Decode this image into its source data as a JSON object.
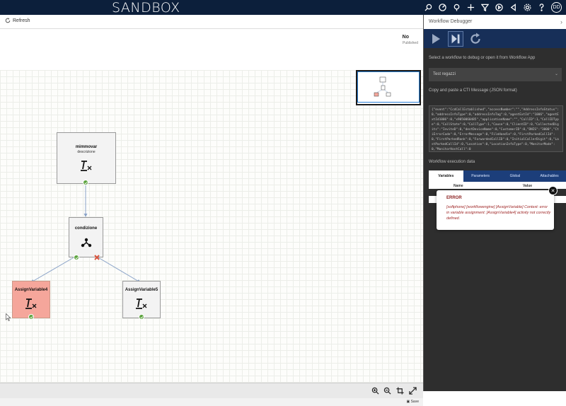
{
  "app": {
    "title": "SANDBOX",
    "user_initials": "DD"
  },
  "topbar": {
    "icons": [
      "search-icon",
      "gauge-icon",
      "pin-icon",
      "plus-icon",
      "filter-icon",
      "play-circle-icon",
      "back-icon",
      "gear-icon",
      "help-icon"
    ]
  },
  "toolbar": {
    "refresh_label": "Refresh"
  },
  "status": {
    "published_value": "No",
    "published_label": "Published"
  },
  "workflow": {
    "nodes": [
      {
        "title": "mimmovar",
        "description": "descrizione",
        "icon": "variable-icon"
      },
      {
        "title": "condizione",
        "description": "",
        "icon": "branch-icon"
      },
      {
        "title": "AssignVariable4",
        "description": "",
        "icon": "variable-icon",
        "state": "error"
      },
      {
        "title": "AssignVariable5",
        "description": "",
        "icon": "variable-icon"
      }
    ]
  },
  "zoombar": {
    "icons": [
      "zoom-in-icon",
      "zoom-out-icon",
      "crop-icon",
      "fullscreen-icon"
    ]
  },
  "savebar": {
    "label": "Save"
  },
  "debugger": {
    "title": "Workflow Debugger",
    "select_prompt": "Select a workflow to debug or open it from Workflow App",
    "selected_workflow": "Test regazzi",
    "json_label": "Copy and paste a CTI Message (JSON format)",
    "json_text": "{\"event\":\"CcdCallEstablished\",\"accessNumber\":\"\",\"AddressInfoStatus\":0,\"addressInfoType\":0,\"addressInfoTag\":0,\"agentExtId\":\"1006\",\"agentExtId1006\":0,\"x9050060485\",\"applicationName\":\"\",\"CallID\":1,\"CallIDType\":0,\"CallState\":0,\"CallType\":1,\"Cause\":0,\"ClientID\":0,\"CollectedDigits\":\"InviteD\":0,\"destDeviceName\":0,\"CustomerID\":0,\"DNIS\":\"3000\",\"CtiErrorCode\":0,\"ErrorMessage\":0,\"FileHandle\":0,\"FirstParkedCallId\":0,\"FirstParkedRank\":0,\"ForwardedCallID\":0,\"InitialCallerDigit\":0,\"LastParkedCallId\":0,\"Location\":0,\"LocationInfoType\":0,\"MonitorMode\":0,\"MonitorHostCall\":0",
    "execution_label": "Workflow execution data",
    "tabs": [
      "Variables",
      "Parameters",
      "Global",
      "Attachables"
    ],
    "table_headers": [
      "Name",
      "Value"
    ]
  },
  "error": {
    "title": "ERROR",
    "message": "[softphone] [workflowengine] [AssignVariable] Context: error in variable assignment: [AssignVariable4] activity not correctly defined."
  }
}
